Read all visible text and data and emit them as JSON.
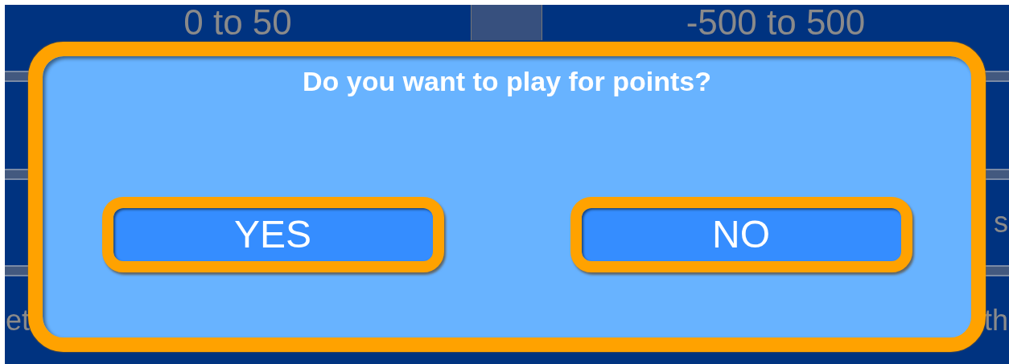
{
  "background": {
    "header_cells": [
      "0 to 50",
      "-500 to 500"
    ],
    "left_labels": [
      "et"
    ],
    "right_labels": [
      "s",
      "th"
    ]
  },
  "dialog": {
    "title": "Do you want to play for points?",
    "buttons": [
      "YES",
      "NO"
    ]
  }
}
